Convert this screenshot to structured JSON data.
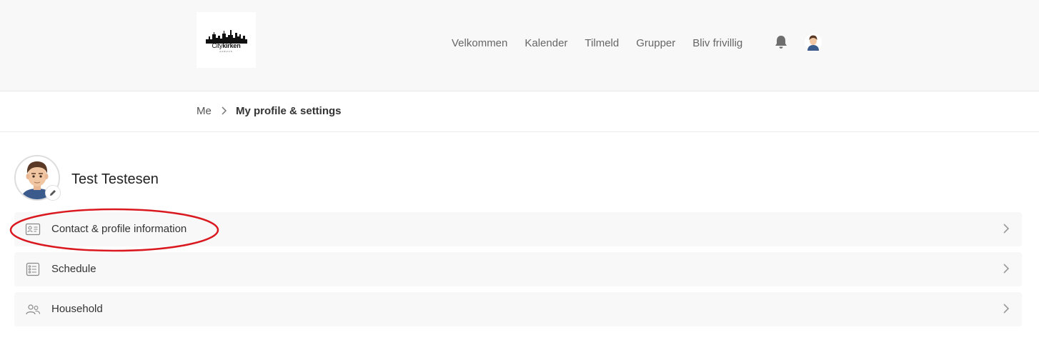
{
  "header": {
    "logo": {
      "text_light": "City",
      "text_bold": "kirken",
      "subtext": "AARHUS"
    },
    "nav": [
      "Velkommen",
      "Kalender",
      "Tilmeld",
      "Grupper",
      "Bliv frivillig"
    ],
    "icons": {
      "notifications": "bell-icon",
      "account": "user-avatar-icon"
    }
  },
  "breadcrumb": {
    "items": [
      "Me",
      "My profile & settings"
    ]
  },
  "profile": {
    "name": "Test Testesen",
    "edit_icon": "pencil-icon"
  },
  "menu": [
    {
      "label": "Contact & profile information",
      "icon": "contact-card-icon"
    },
    {
      "label": "Schedule",
      "icon": "checklist-icon"
    },
    {
      "label": "Household",
      "icon": "people-icon"
    }
  ],
  "annotation": {
    "color": "#d9191f",
    "target": "Contact & profile information"
  },
  "colors": {
    "header_bg": "#f8f8f8",
    "row_bg": "#f8f8f8",
    "text": "#333333",
    "nav_text": "#666666"
  }
}
